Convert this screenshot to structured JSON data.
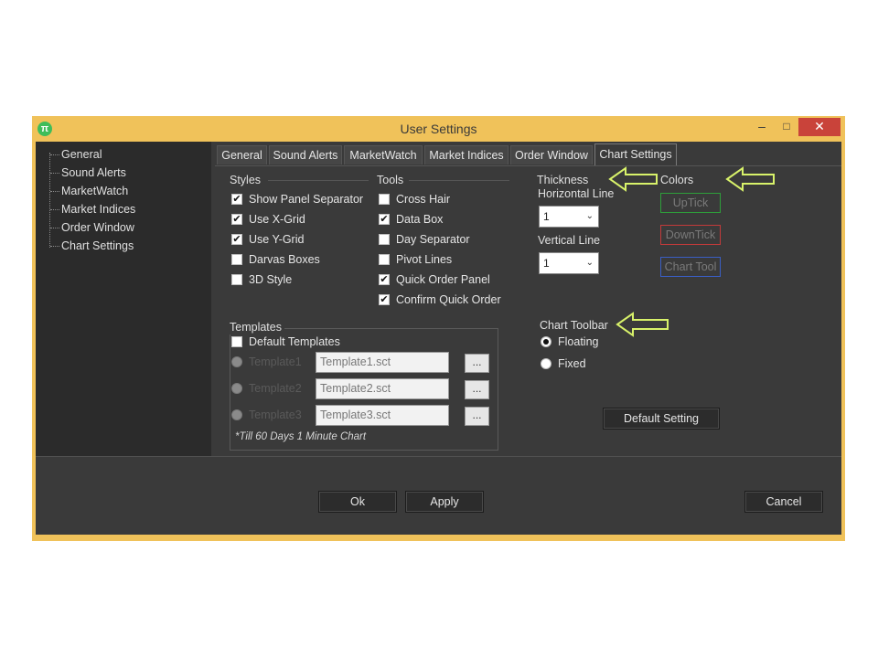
{
  "window": {
    "title": "User Settings",
    "app_icon_glyph": "π",
    "minimize_glyph": "–",
    "maximize_glyph": "□",
    "close_glyph": "✕"
  },
  "sidebar": {
    "items": [
      {
        "label": "General"
      },
      {
        "label": "Sound Alerts"
      },
      {
        "label": "MarketWatch"
      },
      {
        "label": "Market Indices"
      },
      {
        "label": "Order Window"
      },
      {
        "label": "Chart Settings"
      }
    ]
  },
  "tabs": [
    {
      "label": "General"
    },
    {
      "label": "Sound Alerts"
    },
    {
      "label": "MarketWatch"
    },
    {
      "label": "Market Indices"
    },
    {
      "label": "Order Window"
    },
    {
      "label": "Chart Settings",
      "active": true
    }
  ],
  "styles": {
    "heading": "Styles",
    "options": [
      {
        "label": "Show Panel Separator",
        "checked": true
      },
      {
        "label": "Use X-Grid",
        "checked": true
      },
      {
        "label": "Use Y-Grid",
        "checked": true
      },
      {
        "label": "Darvas Boxes",
        "checked": false
      },
      {
        "label": "3D Style",
        "checked": false
      }
    ]
  },
  "tools": {
    "heading": "Tools",
    "options": [
      {
        "label": "Cross Hair",
        "checked": false
      },
      {
        "label": "Data Box",
        "checked": true
      },
      {
        "label": "Day Separator",
        "checked": false
      },
      {
        "label": "Pivot Lines",
        "checked": false
      },
      {
        "label": "Quick Order Panel",
        "checked": true
      },
      {
        "label": "Confirm Quick Order",
        "checked": true
      }
    ]
  },
  "thickness": {
    "heading": "Thickness",
    "horizontal_label": "Horizontal Line",
    "horizontal_value": "1",
    "vertical_label": "Vertical Line",
    "vertical_value": "1",
    "caret": "⌄"
  },
  "colors": {
    "heading": "Colors",
    "buttons": [
      {
        "label": "UpTick",
        "color": "#2e9e3a"
      },
      {
        "label": "DownTick",
        "color": "#c33a3a"
      },
      {
        "label": "Chart Tool",
        "color": "#3a5ec4"
      }
    ]
  },
  "chart_toolbar": {
    "heading": "Chart Toolbar",
    "options": [
      {
        "label": "Floating",
        "selected": true
      },
      {
        "label": "Fixed",
        "selected": false
      }
    ]
  },
  "templates": {
    "heading": "Templates",
    "default_label": "Default Templates",
    "default_checked": false,
    "rows": [
      {
        "label": "Template1",
        "value": "Template1.sct",
        "button": "..."
      },
      {
        "label": "Template2",
        "value": "Template2.sct",
        "button": "..."
      },
      {
        "label": "Template3",
        "value": "Template3.sct",
        "button": "..."
      }
    ],
    "note": "*Till 60 Days 1 Minute Chart"
  },
  "buttons": {
    "default_setting": "Default Setting",
    "ok": "Ok",
    "apply": "Apply",
    "cancel": "Cancel"
  },
  "annotation_color": "#d8f26a",
  "check_glyph": "✔"
}
